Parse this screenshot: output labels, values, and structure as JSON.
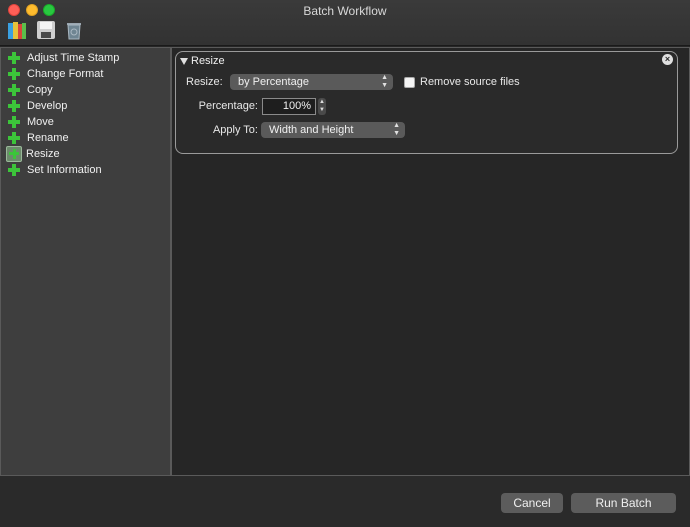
{
  "window": {
    "title": "Batch Workflow"
  },
  "toolbar": {
    "icons": [
      "books-icon",
      "save-icon",
      "trash-icon"
    ]
  },
  "sidebar": {
    "items": [
      {
        "label": "Adjust Time Stamp",
        "icon": "plus-icon"
      },
      {
        "label": "Change Format",
        "icon": "plus-icon"
      },
      {
        "label": "Copy",
        "icon": "plus-icon"
      },
      {
        "label": "Develop",
        "icon": "plus-icon"
      },
      {
        "label": "Move",
        "icon": "plus-icon"
      },
      {
        "label": "Rename",
        "icon": "plus-icon"
      },
      {
        "label": "Resize",
        "icon": "resize-icon"
      },
      {
        "label": "Set Information",
        "icon": "plus-icon"
      }
    ]
  },
  "resize_panel": {
    "title": "Resize",
    "resize_label": "Resize:",
    "resize_value": "by Percentage",
    "remove_source_label": "Remove source files",
    "remove_source_checked": false,
    "percentage_label": "Percentage:",
    "percentage_value": "100%",
    "apply_to_label": "Apply To:",
    "apply_to_value": "Width and Height"
  },
  "footer": {
    "cancel_label": "Cancel",
    "run_label": "Run Batch"
  },
  "colors": {
    "plus_green": "#3cc43a",
    "background": "#262626",
    "sidebar": "#3e3e3e"
  }
}
